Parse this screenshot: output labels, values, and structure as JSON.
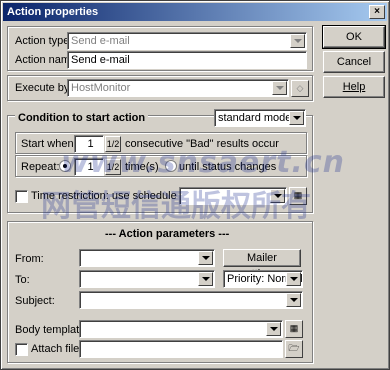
{
  "window": {
    "title": "Action properties",
    "close_glyph": "×"
  },
  "buttons": {
    "ok": "OK",
    "cancel": "Cancel",
    "help": "Help"
  },
  "general": {
    "action_type_label": "Action type",
    "action_type_value": "Send e-mail",
    "action_name_label": "Action name",
    "action_name_value": "Send e-mail",
    "execute_by_label": "Execute by",
    "execute_by_value": "HostMonitor"
  },
  "condition": {
    "title": "Condition to start action",
    "mode_value": "standard mode",
    "start_when_label": "Start when",
    "start_when_count": "1",
    "start_when_suffix": "consecutive \"Bad\" results occur",
    "repeat_label": "Repeat:",
    "repeat_count": "1",
    "repeat_times_label": "time(s)",
    "repeat_until_label": "until status changes",
    "time_restriction_label": "Time restriction: use schedule",
    "schedule_value": ""
  },
  "params": {
    "title": "--- Action parameters ---",
    "from_label": "From:",
    "from_value": "",
    "mailer_settings": "Mailer settings..",
    "to_label": "To:",
    "to_value": "",
    "priority_value": "Priority: Normal",
    "subject_label": "Subject:",
    "subject_value": "",
    "body_template_label": "Body template",
    "body_template_value": "",
    "attach_file_label": "Attach file",
    "attach_file_value": ""
  },
  "spin_glyph": "1/2",
  "watermark": {
    "line1": "www.snsaert.cn",
    "line2": "网管短信通版权所有"
  }
}
